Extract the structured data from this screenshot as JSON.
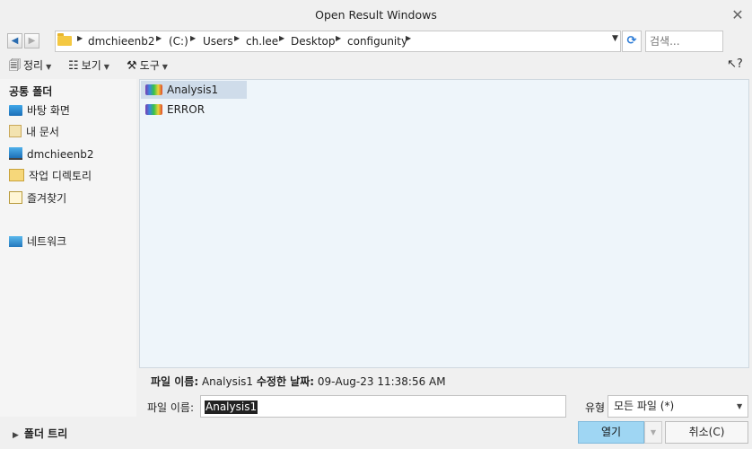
{
  "window": {
    "title": "Open Result Windows"
  },
  "address": {
    "crumbs": [
      "dmchieenb2",
      "(C:)",
      "Users",
      "ch.lee",
      "Desktop",
      "configunity"
    ]
  },
  "search": {
    "placeholder": "검색..."
  },
  "toolbar": {
    "organize": "정리",
    "view": "보기",
    "tools": "도구"
  },
  "sidebar": {
    "section": "공통 폴더",
    "items": [
      {
        "label": "바탕 화면",
        "icon": "desktop-icon"
      },
      {
        "label": "내 문서",
        "icon": "documents-icon"
      },
      {
        "label": "dmchieenb2",
        "icon": "computer-icon"
      },
      {
        "label": "작업 디렉토리",
        "icon": "working-dir-icon"
      },
      {
        "label": "즐겨찾기",
        "icon": "favorites-icon"
      },
      {
        "label": "네트워크",
        "icon": "network-icon"
      }
    ],
    "folder_tree": "폴더 트리"
  },
  "files": [
    {
      "name": "Analysis1",
      "selected": true
    },
    {
      "name": "ERROR",
      "selected": false
    }
  ],
  "info": {
    "name_label": "파일 이름:",
    "name_value": "Analysis1",
    "date_label": "수정한 날짜:",
    "date_value": "09-Aug-23 11:38:56 AM"
  },
  "form": {
    "filename_label": "파일 이름:",
    "filename_value": "Analysis1",
    "type_label": "유형",
    "type_value": "모든 파일 (*)"
  },
  "buttons": {
    "open": "열기",
    "cancel": "취소(C)"
  },
  "colors": {
    "accent": "#9fd6f3",
    "selection": "#cfdcea",
    "file_pane": "#eef5fa"
  }
}
